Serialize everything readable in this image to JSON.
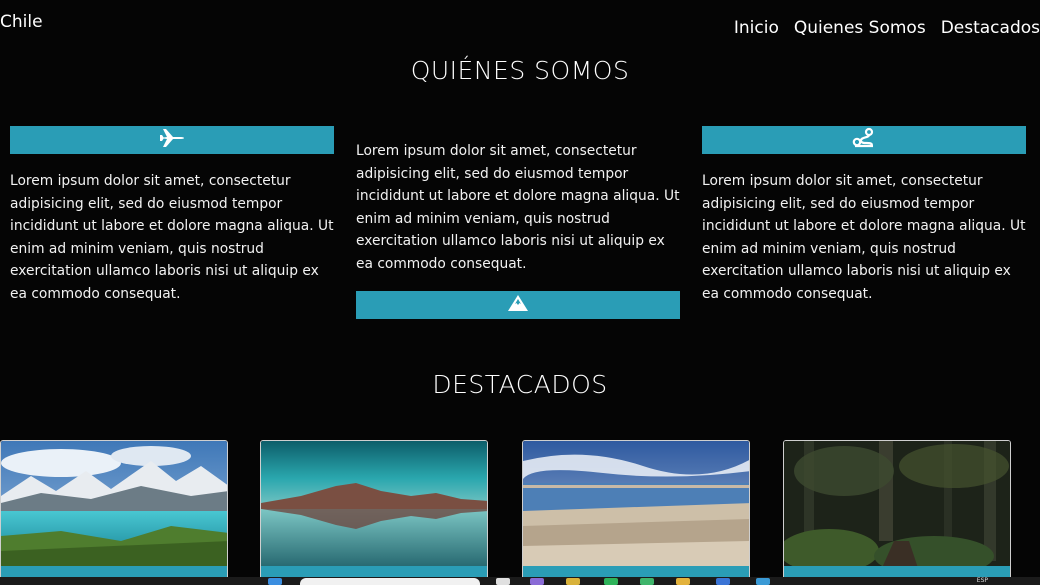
{
  "header": {
    "brand": "Chile",
    "nav": [
      "Inicio",
      "Quienes Somos",
      "Destacados"
    ]
  },
  "about": {
    "title": "QUIÉNES SOMOS",
    "cards": [
      {
        "icon": "airplane-icon",
        "text": "Lorem ipsum dolor sit amet, consectetur adipisicing elit, sed do eiusmod tempor incididunt ut labore et dolore magna aliqua. Ut enim ad minim veniam, quis nostrud exercitation ullamco laboris nisi ut aliquip ex ea commodo consequat."
      },
      {
        "icon": "mountain-icon",
        "text": "Lorem ipsum dolor sit amet, consectetur adipisicing elit, sed do eiusmod tempor incididunt ut labore et dolore magna aliqua. Ut enim ad minim veniam, quis nostrud exercitation ullamco laboris nisi ut aliquip ex ea commodo consequat."
      },
      {
        "icon": "route-icon",
        "text": "Lorem ipsum dolor sit amet, consectetur adipisicing elit, sed do eiusmod tempor incididunt ut labore et dolore magna aliqua. Ut enim ad minim veniam, quis nostrud exercitation ullamco laboris nisi ut aliquip ex ea commodo consequat."
      }
    ]
  },
  "featured": {
    "title": "DESTACADOS",
    "images": [
      "torres-del-paine-lake-image",
      "volcano-reflection-image",
      "salt-flat-lagoon-image",
      "forest-ferns-image"
    ]
  },
  "taskbar": {
    "lang": "ESP"
  },
  "colors": {
    "accent": "#2a9db6",
    "background": "#050505"
  }
}
